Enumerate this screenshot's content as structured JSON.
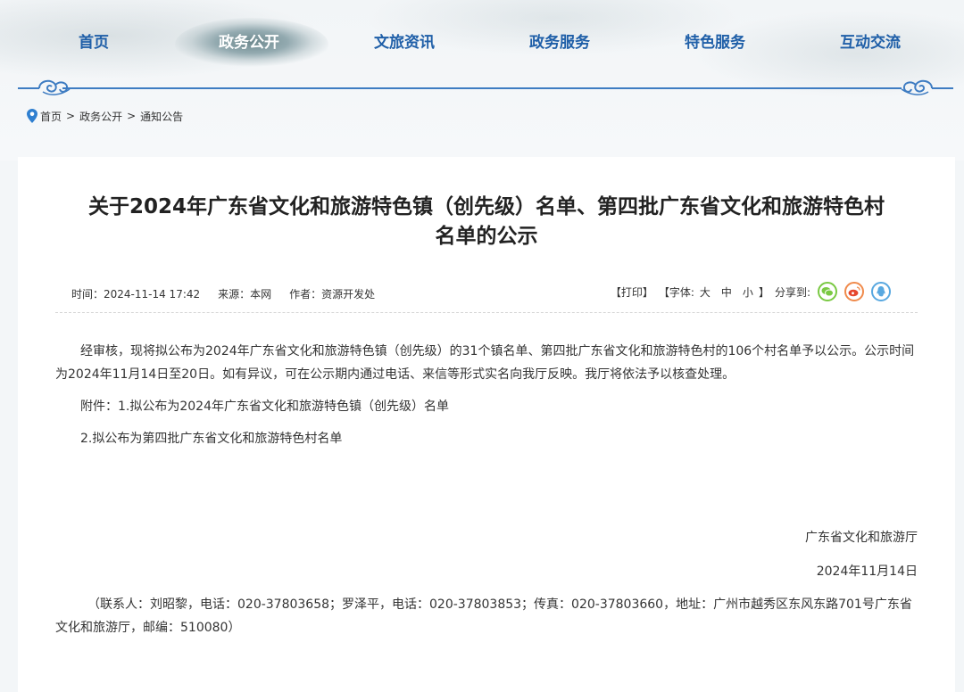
{
  "nav": {
    "items": [
      {
        "label": "首页"
      },
      {
        "label": "政务公开"
      },
      {
        "label": "文旅资讯"
      },
      {
        "label": "政务服务"
      },
      {
        "label": "特色服务"
      },
      {
        "label": "互动交流"
      }
    ],
    "active_index": 1
  },
  "breadcrumb": {
    "items": [
      "首页",
      "政务公开",
      "通知公告"
    ],
    "separator": ">"
  },
  "article": {
    "title_line1": "关于2024年广东省文化和旅游特色镇（创先级）名单、第四批广东省文化和旅游特色村",
    "title_line2": "名单的公示",
    "time": "时间：2024-11-14 17:42",
    "source": "来源：本网",
    "author": "作者：资源开发处",
    "print": "【打印】",
    "font_label": "【字体:",
    "font_large": "大",
    "font_medium": "中",
    "font_small": "小",
    "font_close": "】",
    "share_label": "分享到:",
    "paragraph1": "经审核，现将拟公布为2024年广东省文化和旅游特色镇（创先级）的31个镇名单、第四批广东省文化和旅游特色村的106个村名单予以公示。公示时间为2024年11月14日至20日。如有异议，可在公示期内通过电话、来信等形式实名向我厅反映。我厅将依法予以核查处理。",
    "attachment1": "附件：1.拟公布为2024年广东省文化和旅游特色镇（创先级）名单",
    "attachment2": "2.拟公布为第四批广东省文化和旅游特色村名单",
    "signature": "广东省文化和旅游厅",
    "date": "2024年11月14日",
    "contact": "（联系人：刘昭黎，电话：020-37803658；罗泽平，电话：020-37803853；传真：020-37803660，地址：广州市越秀区东风东路701号广东省文化和旅游厅，邮编：510080）"
  },
  "colors": {
    "nav_text": "#1f5fa8",
    "divider": "#3e7cc2",
    "wechat": "#7ac943",
    "weibo": "#f08a4b",
    "qq": "#58a8e0"
  }
}
